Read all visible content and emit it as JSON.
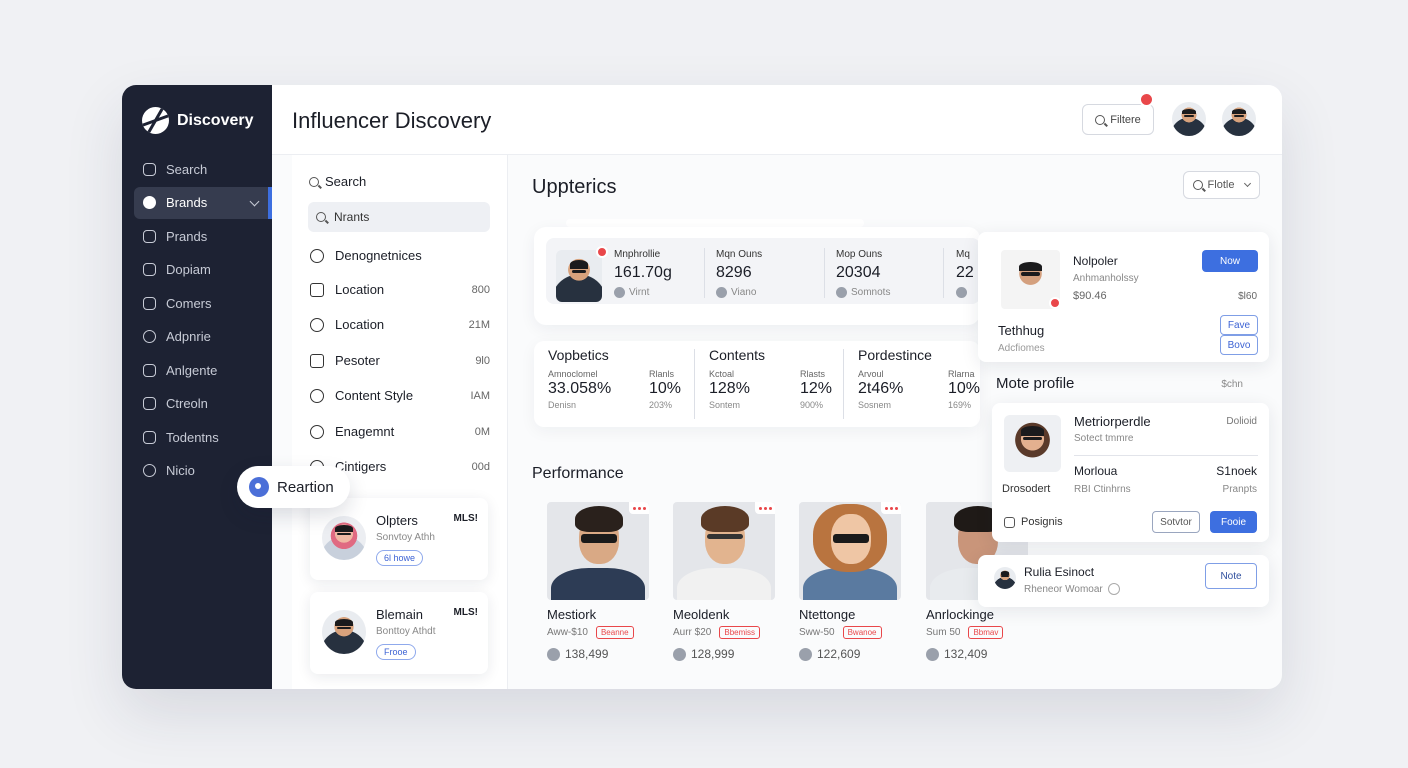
{
  "sidebar": {
    "brand": "Discovery",
    "items": [
      {
        "label": "Search",
        "icon": "search-icon"
      },
      {
        "label": "Brands",
        "icon": "brands-icon",
        "active": true
      },
      {
        "label": "Prands",
        "icon": "tag-icon"
      },
      {
        "label": "Dopiam",
        "icon": "camera-icon"
      },
      {
        "label": "Comers",
        "icon": "users-icon"
      },
      {
        "label": "Adpnrie",
        "icon": "chat-icon"
      },
      {
        "label": "Anlgente",
        "icon": "check-icon"
      },
      {
        "label": "Ctreoln",
        "icon": "checkbox-icon"
      },
      {
        "label": "Todentns",
        "icon": "briefcase-icon"
      },
      {
        "label": "Nicio",
        "icon": "tag-icon"
      }
    ]
  },
  "floating_chip": {
    "label": "Reartion"
  },
  "header": {
    "title": "Influencer Discovery",
    "filter_label": "Filtere"
  },
  "filters": {
    "search_label": "Search",
    "search_value": "Nrants",
    "rows": [
      {
        "label": "Denognetnices",
        "count": ""
      },
      {
        "label": "Location",
        "count": "800"
      },
      {
        "label": "Location",
        "count": "21M"
      },
      {
        "label": "Pesoter",
        "count": "9l0"
      },
      {
        "label": "Content Style",
        "count": "IAM"
      },
      {
        "label": "Enagemnt",
        "count": "0M"
      },
      {
        "label": "Cintigers",
        "count": "00d"
      }
    ],
    "cards": [
      {
        "name": "Olpters",
        "sub": "Sonvtoy Athh",
        "badge": "6l howe",
        "tag": "MLS!"
      },
      {
        "name": "Blemain",
        "sub": "Bonttoy Athdt",
        "badge": "Frooe",
        "tag": "MLS!"
      }
    ]
  },
  "main": {
    "title": "Uppterics",
    "filter_label": "Flotle",
    "stats": [
      {
        "label": "Mnphrollie",
        "value": "161.70g",
        "sub": "Virnt"
      },
      {
        "label": "Mqn Ouns",
        "value": "8296",
        "sub": "Viano"
      },
      {
        "label": "Mop Ouns",
        "value": "20304",
        "sub": "Somnots"
      },
      {
        "label": "Mq",
        "value": "22",
        "sub": ""
      }
    ],
    "metrics": [
      {
        "title": "Vopbetics",
        "a_label": "Amnoclomel",
        "a_value": "33.058%",
        "a_foot": "Denisn",
        "b_label": "Rlanls",
        "b_value": "10%",
        "b_foot": "203%"
      },
      {
        "title": "Contents",
        "a_label": "Kctoal",
        "a_value": "128%",
        "a_foot": "Sontem",
        "b_label": "Rlasts",
        "b_value": "12%",
        "b_foot": "900%"
      },
      {
        "title": "Pordestince",
        "a_label": "Arvoul",
        "a_value": "2t46%",
        "a_foot": "Sosnem",
        "b_label": "Rlarna",
        "b_value": "10%",
        "b_foot": "169%"
      }
    ],
    "performance_title": "Performance",
    "people": [
      {
        "name": "Mestiork",
        "rate": "Aww-$10",
        "tag": "Beanne",
        "followers": "138,499",
        "shirt": "#2d3c55"
      },
      {
        "name": "Meoldenk",
        "rate": "Aurr $20",
        "tag": "Bbemiss",
        "followers": "128,999",
        "shirt": "#f1f1f1"
      },
      {
        "name": "Ntettonge",
        "rate": "Sww-50",
        "tag": "Bwanoe",
        "followers": "122,609",
        "shirt": "#5a7aa0"
      },
      {
        "name": "Anrlockinge",
        "rate": "Sum 50",
        "tag": "Bbmav",
        "followers": "132,409",
        "shirt": "#e8ebee"
      }
    ]
  },
  "right": {
    "card1": {
      "name": "Nolpoler",
      "sub": "Anhmanholssy",
      "price": "$90.46",
      "price_right": "$l60",
      "btn": "Now",
      "title2": "Tethhug",
      "sub2": "Adcfiomes",
      "btn2": "Fave",
      "btn3": "Bovo"
    },
    "more_title": "Mote profile",
    "more_right": "$chn",
    "card2": {
      "name": "Metriorperdle",
      "sub": "Sotect tmmre",
      "right_top": "Dolioid",
      "row_name": "Morloua",
      "row_right": "S1noek",
      "label": "Drosodert",
      "row_sub": "RBI Ctinhrns",
      "row_sub_right": "Pranpts",
      "footer": "Posignis",
      "btn_out": "Sotvtor",
      "btn_blue": "Fooie"
    },
    "card3": {
      "name": "Rulia Esinoct",
      "sub": "Rheneor Womoar",
      "btn": "Note"
    }
  }
}
